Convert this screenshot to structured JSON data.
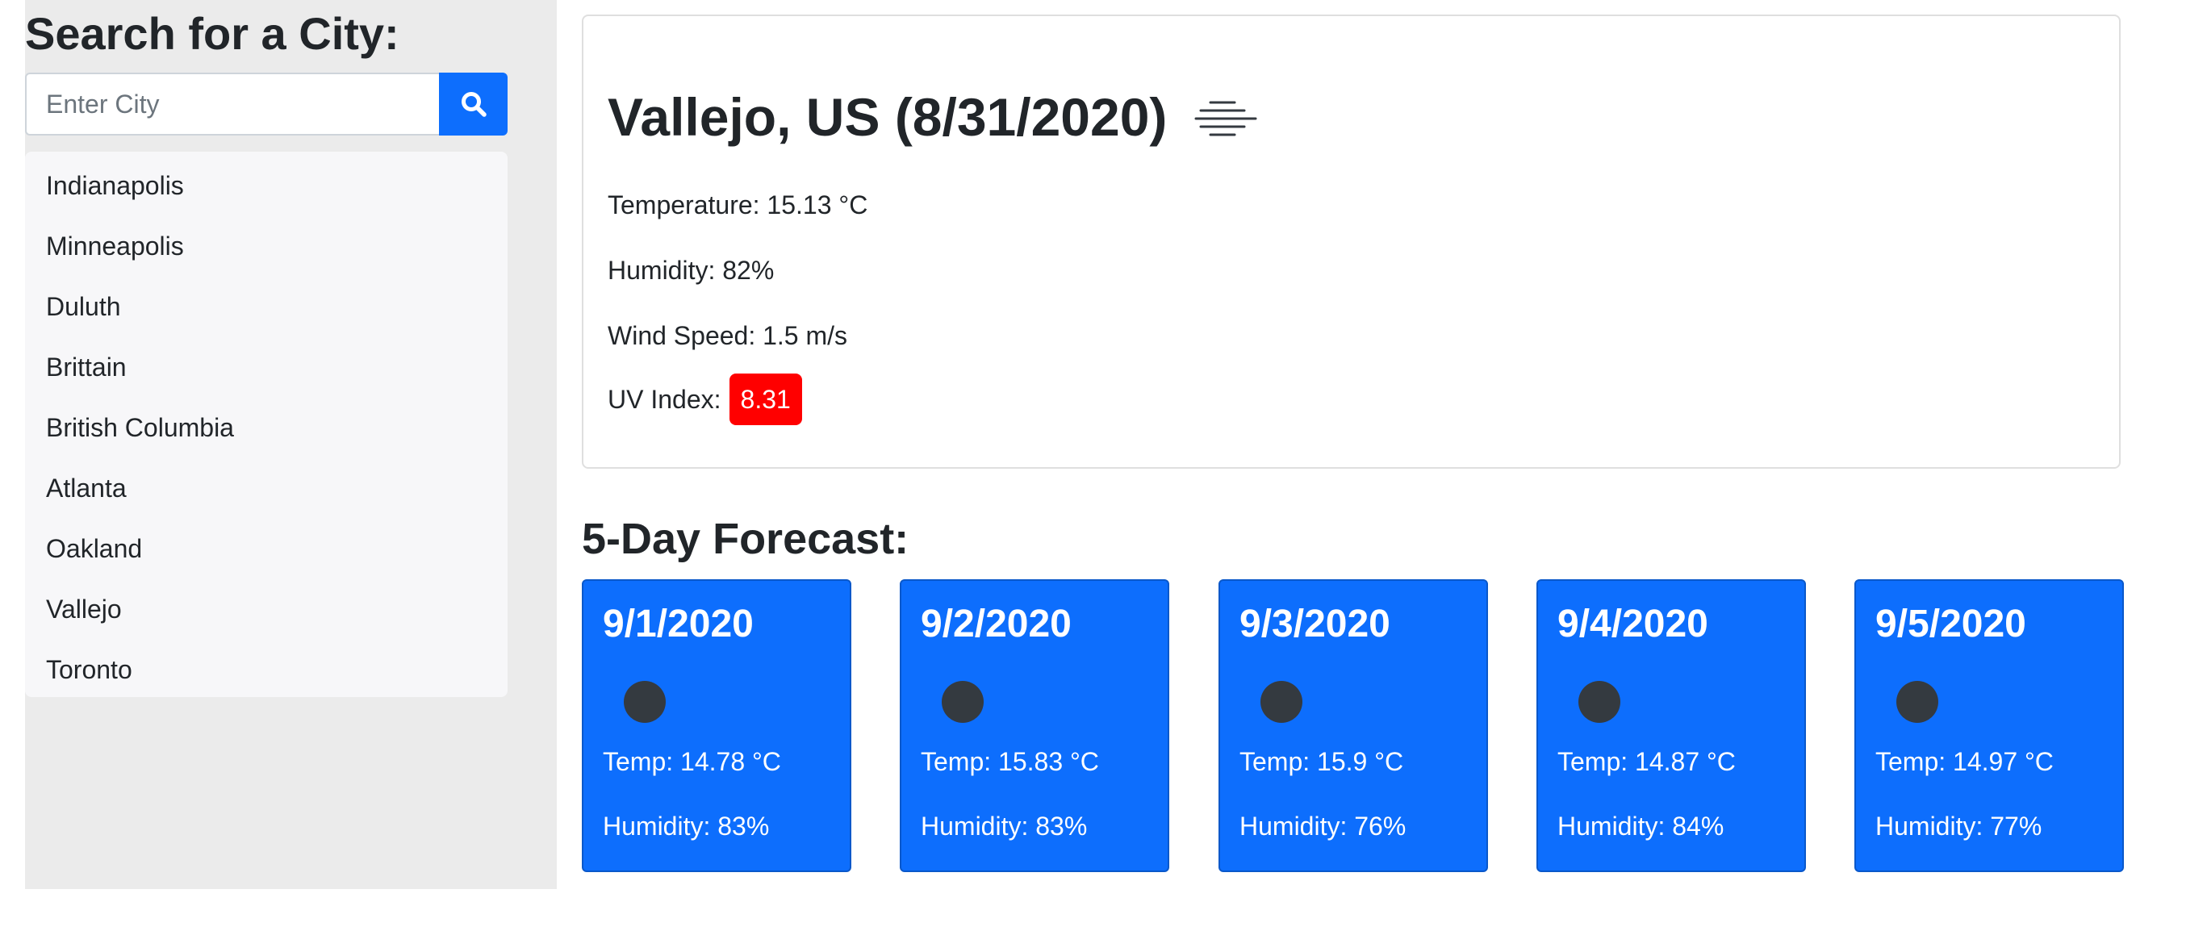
{
  "sidebar": {
    "title": "Search for a City:",
    "search": {
      "placeholder": "Enter City",
      "value": ""
    },
    "search_button_icon": "search-icon",
    "history": [
      "Indianapolis",
      "Minneapolis",
      "Duluth",
      "Brittain",
      "British Columbia",
      "Atlanta",
      "Oakland",
      "Vallejo",
      "Toronto"
    ]
  },
  "current": {
    "heading": "Vallejo, US (8/31/2020)",
    "weather_icon": "fog-icon",
    "temperature": "Temperature: 15.13 °C",
    "humidity": "Humidity: 82%",
    "wind": "Wind Speed: 1.5 m/s",
    "uv_label": "UV Index:",
    "uv_value": "8.31",
    "uv_color": "#ff0000"
  },
  "forecast": {
    "title": "5-Day Forecast:",
    "days": [
      {
        "date": "9/1/2020",
        "icon": "weather-icon",
        "temp": "Temp: 14.78 °C",
        "humidity": "Humidity: 83%"
      },
      {
        "date": "9/2/2020",
        "icon": "weather-icon",
        "temp": "Temp: 15.83 °C",
        "humidity": "Humidity: 83%"
      },
      {
        "date": "9/3/2020",
        "icon": "weather-icon",
        "temp": "Temp: 15.9 °C",
        "humidity": "Humidity: 76%"
      },
      {
        "date": "9/4/2020",
        "icon": "weather-icon",
        "temp": "Temp: 14.87 °C",
        "humidity": "Humidity: 84%"
      },
      {
        "date": "9/5/2020",
        "icon": "weather-icon",
        "temp": "Temp: 14.97 °C",
        "humidity": "Humidity: 77%"
      }
    ]
  },
  "colors": {
    "primary": "#0d6efd",
    "sidebar_bg": "#ebebeb",
    "uv_high": "#ff0000"
  }
}
